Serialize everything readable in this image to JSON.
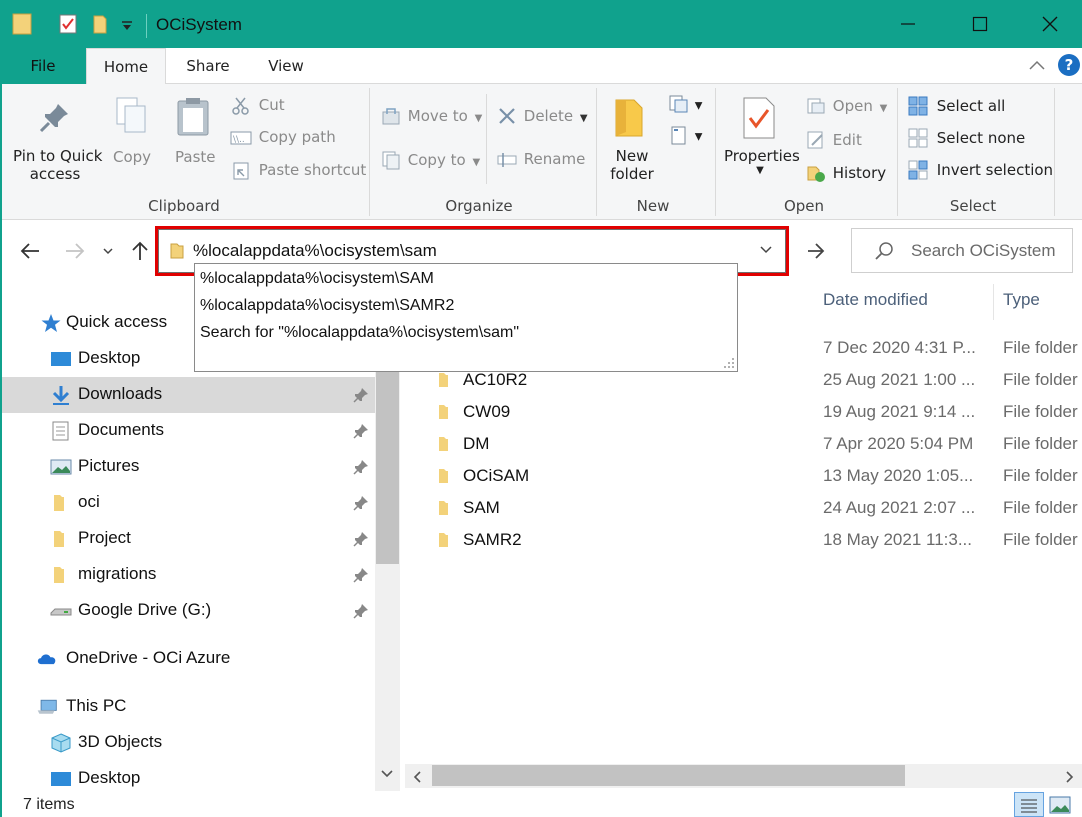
{
  "window": {
    "title": "OCiSystem",
    "accent_color": "#10a28d"
  },
  "ribbon_tabs": {
    "file": "File",
    "home": "Home",
    "share": "Share",
    "view": "View"
  },
  "ribbon": {
    "clipboard": {
      "pin": "Pin to Quick",
      "pin2": "access",
      "copy": "Copy",
      "paste": "Paste",
      "cut": "Cut",
      "copy_path": "Copy path",
      "paste_shortcut": "Paste shortcut",
      "group": "Clipboard"
    },
    "organize": {
      "move_to": "Move to",
      "copy_to": "Copy to",
      "delete": "Delete",
      "rename": "Rename",
      "group": "Organize"
    },
    "new": {
      "new_folder": "New",
      "new_folder2": "folder",
      "group": "New"
    },
    "open": {
      "properties": "Properties",
      "open": "Open",
      "edit": "Edit",
      "history": "History",
      "group": "Open"
    },
    "select": {
      "select_all": "Select all",
      "select_none": "Select none",
      "invert": "Invert selection",
      "group": "Select"
    }
  },
  "address_bar": {
    "value": "%localappdata%\\ocisystem\\sam",
    "highlight_color": "#e00000"
  },
  "search": {
    "placeholder": "Search OCiSystem"
  },
  "autocomplete": [
    "%localappdata%\\ocisystem\\SAM",
    "%localappdata%\\ocisystem\\SAMR2",
    "Search for \"%localappdata%\\ocisystem\\sam\""
  ],
  "sidebar": {
    "quick_access": "Quick access",
    "items": [
      {
        "label": "Desktop"
      },
      {
        "label": "Downloads"
      },
      {
        "label": "Documents"
      },
      {
        "label": "Pictures"
      },
      {
        "label": "oci"
      },
      {
        "label": "Project"
      },
      {
        "label": "migrations"
      },
      {
        "label": "Google Drive (G:)"
      }
    ],
    "onedrive": "OneDrive - OCi Azure",
    "this_pc": "This PC",
    "pc_items": [
      {
        "label": "3D Objects"
      },
      {
        "label": "Desktop"
      }
    ]
  },
  "columns": {
    "date_modified": "Date modified",
    "type": "Type"
  },
  "files": [
    {
      "name": "",
      "date": "7 Dec 2020 4:31 P...",
      "type": "File folder"
    },
    {
      "name": "AC10R2",
      "date": "25 Aug 2021 1:00 ...",
      "type": "File folder"
    },
    {
      "name": "CW09",
      "date": "19 Aug 2021 9:14 ...",
      "type": "File folder"
    },
    {
      "name": "DM",
      "date": "7 Apr 2020 5:04 PM",
      "type": "File folder"
    },
    {
      "name": "OCiSAM",
      "date": "13 May 2020 1:05...",
      "type": "File folder"
    },
    {
      "name": "SAM",
      "date": "24 Aug 2021 2:07 ...",
      "type": "File folder"
    },
    {
      "name": "SAMR2",
      "date": "18 May 2021 11:3...",
      "type": "File folder"
    }
  ],
  "status": {
    "items": "7 items"
  }
}
